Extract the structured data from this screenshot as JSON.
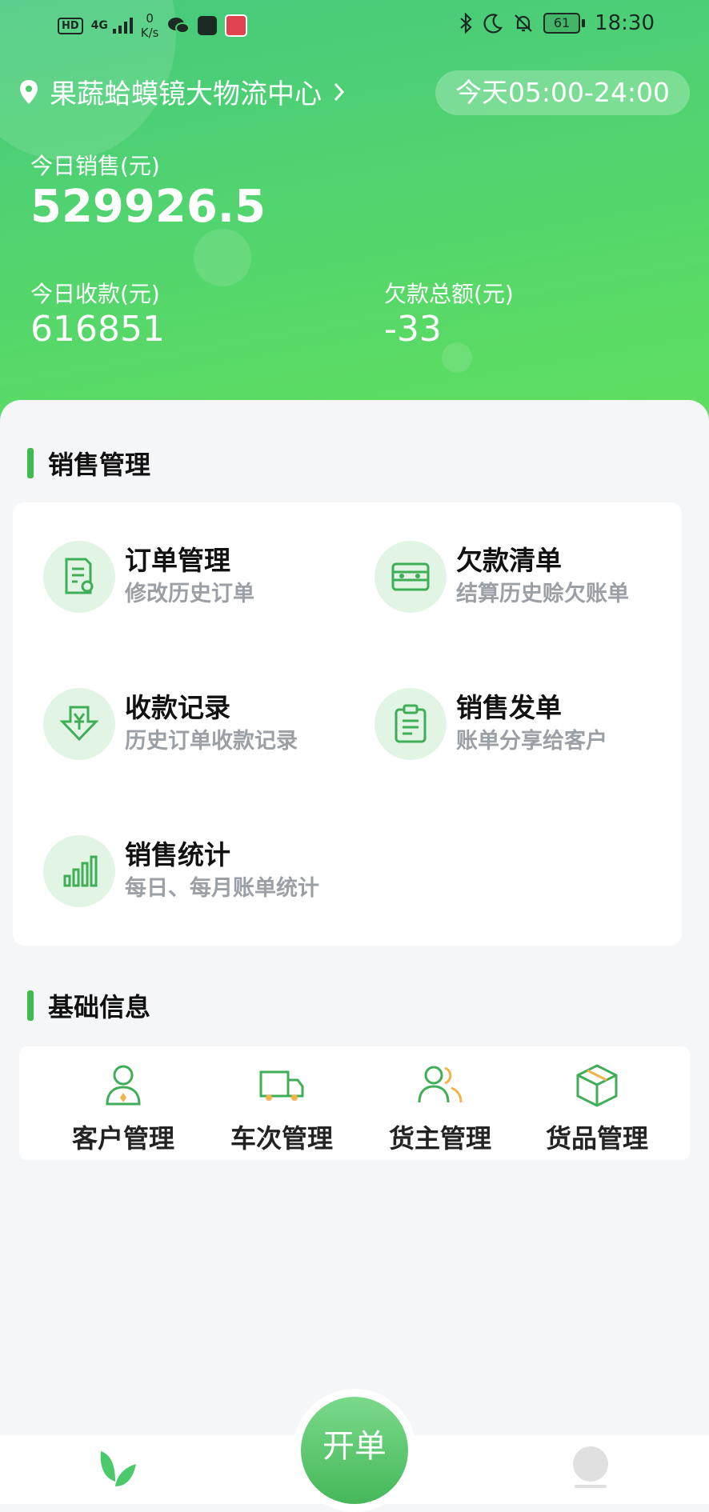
{
  "status_bar": {
    "hd": "HD",
    "network": "4G",
    "speed_value": "0",
    "speed_unit": "K/s",
    "battery": "61",
    "time": "18:30",
    "icons": [
      "wechat-icon",
      "huawei-app-icon",
      "book-app-icon",
      "bluetooth-icon",
      "moon-icon",
      "mute-bell-icon"
    ]
  },
  "header": {
    "location": "果蔬蛤蟆镜大物流中心",
    "hours": "今天05:00-24:00",
    "sales_label": "今日销售(元)",
    "sales_value": "529926.5",
    "received_label": "今日收款(元)",
    "received_value": "616851",
    "debt_label": "欠款总额(元)",
    "debt_value": "-33"
  },
  "sales_section": {
    "title": "销售管理",
    "items": [
      {
        "title": "订单管理",
        "subtitle": "修改历史订单",
        "icon": "order-settings-icon"
      },
      {
        "title": "欠款清单",
        "subtitle": "结算历史赊欠账单",
        "icon": "debt-card-icon"
      },
      {
        "title": "收款记录",
        "subtitle": "历史订单收款记录",
        "icon": "yuan-download-icon"
      },
      {
        "title": "销售发单",
        "subtitle": "账单分享给客户",
        "icon": "clipboard-icon"
      },
      {
        "title": "销售统计",
        "subtitle": "每日、每月账单统计",
        "icon": "bar-chart-icon"
      }
    ]
  },
  "basic_section": {
    "title": "基础信息",
    "items": [
      {
        "label": "客户管理",
        "icon": "customer-icon"
      },
      {
        "label": "车次管理",
        "icon": "truck-icon"
      },
      {
        "label": "货主管理",
        "icon": "owners-icon"
      },
      {
        "label": "货品管理",
        "icon": "package-icon"
      }
    ]
  },
  "tabbar": {
    "fab_label": "开单",
    "home_icon": "leaf-home-icon",
    "me_icon": "profile-icon"
  },
  "colors": {
    "brand_green": "#4cc96a",
    "accent_bar": "#3fba4f",
    "icon_bg": "#e2f5e4"
  }
}
